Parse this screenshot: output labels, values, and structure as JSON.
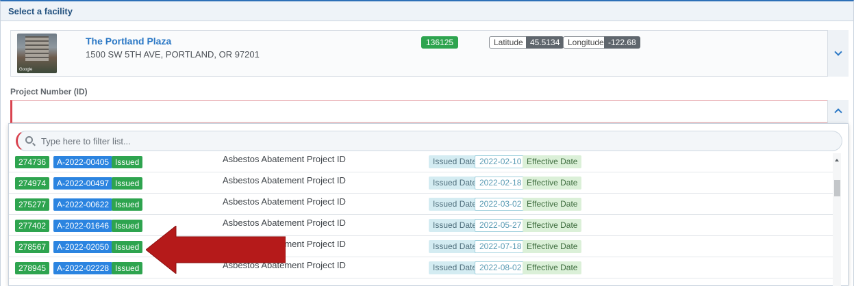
{
  "panel": {
    "title": "Select a facility"
  },
  "facility": {
    "name": "The Portland Plaza",
    "address": "1500 SW 5TH AVE, PORTLAND, OR 97201",
    "thumb_watermark": "Google",
    "id": "136125",
    "latitude_label": "Latitude",
    "latitude": "45.5134",
    "longitude_label": "Longitude",
    "longitude": "-122.68"
  },
  "project_field": {
    "label": "Project Number (ID)",
    "value": ""
  },
  "dropdown": {
    "filter_placeholder": "Type here to filter list...",
    "rows": [
      {
        "id": "274736",
        "project": "A-2022-00405",
        "status": "Issued",
        "type": "Asbestos Abatement Project ID",
        "issued_label": "Issued Date",
        "issued_date": "2022-02-10",
        "effective_label": "Effective Date"
      },
      {
        "id": "274974",
        "project": "A-2022-00497",
        "status": "Issued",
        "type": "Asbestos Abatement Project ID",
        "issued_label": "Issued Date",
        "issued_date": "2022-02-18",
        "effective_label": "Effective Date"
      },
      {
        "id": "275277",
        "project": "A-2022-00622",
        "status": "Issued",
        "type": "Asbestos Abatement Project ID",
        "issued_label": "Issued Date",
        "issued_date": "2022-03-02",
        "effective_label": "Effective Date"
      },
      {
        "id": "277402",
        "project": "A-2022-01646",
        "status": "Issued",
        "type": "Asbestos Abatement Project ID",
        "issued_label": "Issued Date",
        "issued_date": "2022-05-27",
        "effective_label": "Effective Date"
      },
      {
        "id": "278567",
        "project": "A-2022-02050",
        "status": "Issued",
        "type": "Asbestos Abatement Project ID",
        "issued_label": "Issued Date",
        "issued_date": "2022-07-18",
        "effective_label": "Effective Date"
      },
      {
        "id": "278945",
        "project": "A-2022-02228",
        "status": "Issued",
        "type": "Asbestos Abatement Project ID",
        "issued_label": "Issued Date",
        "issued_date": "2022-08-02",
        "effective_label": "Effective Date"
      }
    ]
  },
  "colors": {
    "accent_blue": "#2b78c5",
    "badge_green": "#2ea44f",
    "badge_blue": "#2b84e0",
    "error_red": "#d9434f",
    "annotation_arrow": "#b51a1a"
  },
  "icons": {
    "card_toggle": "chevron-down-icon",
    "input_toggle": "chevron-up-icon",
    "filter": "search-icon",
    "annotation": "red-arrow-pointer"
  }
}
